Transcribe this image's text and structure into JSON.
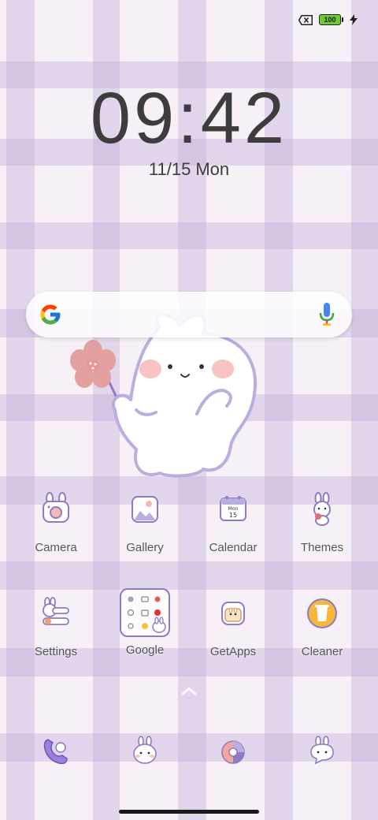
{
  "status_bar": {
    "battery_level": "100",
    "charging": true,
    "sim_status": "no-sim"
  },
  "lock_clock": {
    "time": "09:42",
    "date": "11/15",
    "weekday": "Mon"
  },
  "search_widget": {
    "logo_icon": "google-g-icon",
    "mic_icon": "microphone-icon"
  },
  "apps": [
    {
      "label": "Camera",
      "icon": "bunny-camera-icon"
    },
    {
      "label": "Gallery",
      "icon": "bunny-gallery-icon"
    },
    {
      "label": "Calendar",
      "icon": "bunny-calendar-icon",
      "icon_text_month": "Mon",
      "icon_text_day": "15"
    },
    {
      "label": "Themes",
      "icon": "bunny-themes-icon"
    },
    {
      "label": "Settings",
      "icon": "bunny-settings-icon"
    },
    {
      "label": "Google",
      "icon": "folder-icon"
    },
    {
      "label": "GetApps",
      "icon": "bunny-getapps-icon"
    },
    {
      "label": "Cleaner",
      "icon": "cleaner-icon"
    }
  ],
  "dock": [
    {
      "icon": "phone-icon"
    },
    {
      "icon": "bunny-messages-icon"
    },
    {
      "icon": "browser-icon"
    },
    {
      "icon": "bunny-chat-icon"
    }
  ],
  "colors": {
    "accent_purple": "#8e7cc3",
    "flower_pink": "#e3a0a0",
    "battery_green": "#6acc2e"
  }
}
